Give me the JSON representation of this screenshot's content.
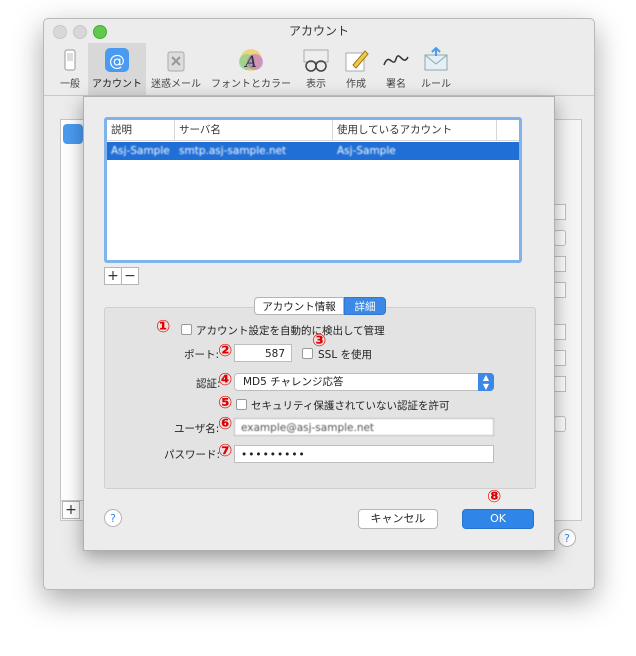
{
  "window": {
    "title": "アカウント"
  },
  "toolbar": {
    "items": [
      {
        "label": "一般",
        "icon": "switch-icon"
      },
      {
        "label": "アカウント",
        "icon": "at-icon"
      },
      {
        "label": "迷惑メール",
        "icon": "trash-icon"
      },
      {
        "label": "フォントとカラー",
        "icon": "font-icon"
      },
      {
        "label": "表示",
        "icon": "glasses-icon"
      },
      {
        "label": "作成",
        "icon": "pencil-icon"
      },
      {
        "label": "署名",
        "icon": "signature-icon"
      },
      {
        "label": "ルール",
        "icon": "envelope-icon"
      }
    ]
  },
  "server_table": {
    "columns": [
      "説明",
      "サーバ名",
      "使用しているアカウント"
    ],
    "rows": [
      {
        "description": "Asj-Sample",
        "server": "smtp.asj-sample.net",
        "account": "Asj-Sample"
      }
    ]
  },
  "list_controls": {
    "add": "+",
    "remove": "−"
  },
  "tabs": {
    "info": "アカウント情報",
    "detail": "詳細"
  },
  "form": {
    "auto_detect_label": "アカウント設定を自動的に検出して管理",
    "port_label": "ポート:",
    "port_value": "587",
    "ssl_label": "SSL を使用",
    "auth_label": "認証:",
    "auth_value": "MD5 チャレンジ応答",
    "insecure_label": "セキュリティ保護されていない認証を許可",
    "username_label": "ユーザ名:",
    "username_value": "example@asj-sample.net",
    "password_label": "パスワード:",
    "password_value": "•••••••••"
  },
  "markers": [
    "①",
    "②",
    "③",
    "④",
    "⑤",
    "⑥",
    "⑦",
    "⑧"
  ],
  "buttons": {
    "cancel": "キャンセル",
    "ok": "OK",
    "help": "?"
  },
  "colors": {
    "accent": "#2f86e8",
    "marker": "#e00000",
    "selection": "#1f6fd6"
  }
}
